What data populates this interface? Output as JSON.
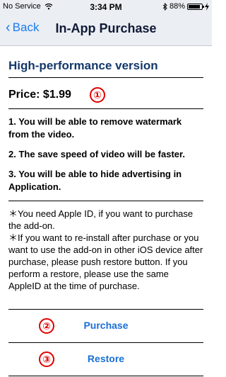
{
  "status_bar": {
    "carrier": "No Service",
    "time": "3:34 PM",
    "battery": "88%",
    "icons": [
      "wifi-icon",
      "bluetooth-icon",
      "battery-icon",
      "charging-icon"
    ]
  },
  "nav": {
    "back_label": "Back",
    "title": "In-App Purchase"
  },
  "product": {
    "title": "High-performance version",
    "price": "Price: $1.99"
  },
  "features": [
    "1. You will be able to remove watermark from the video.",
    "2. The save speed of video will be faster.",
    "3. You will be able to hide advertising in Application."
  ],
  "notes": [
    "＊You need Apple ID, if you want to purchase the add-on.",
    "＊If you want to re-install after purchase or you want to use the add-on in other iOS device  after purchase, please push restore button. If you perform a restore, please use the same AppleID at the time of purchase."
  ],
  "actions": {
    "purchase_label": "Purchase",
    "restore_label": "Restore"
  },
  "markers": {
    "price": "①",
    "purchase": "②",
    "restore": "③"
  },
  "colors": {
    "accent": "#1a7cf2",
    "marker": "#e00000",
    "title": "#14376b"
  }
}
